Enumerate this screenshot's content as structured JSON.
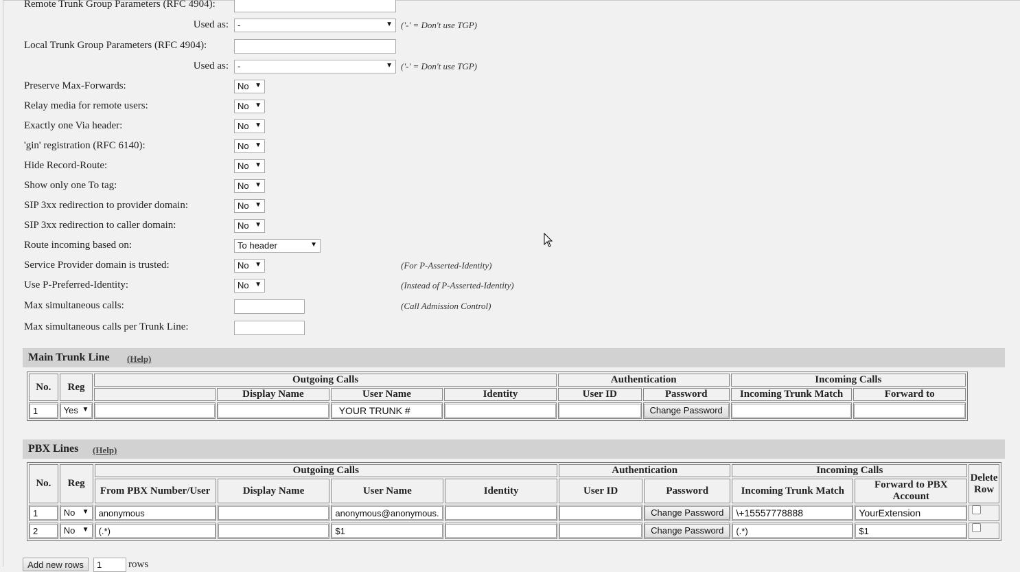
{
  "settings": [
    {
      "label": "Remote Trunk Group Parameters (RFC 4904):",
      "type": "text",
      "value": "",
      "note": ""
    },
    {
      "label": "Used as:",
      "type": "select",
      "value": "-",
      "note": "('-' = Don't use TGP)"
    },
    {
      "label": "Local Trunk Group Parameters (RFC 4904):",
      "type": "text",
      "value": "",
      "note": ""
    },
    {
      "label": "Used as:",
      "type": "select",
      "value": "-",
      "note": "('-' = Don't use TGP)"
    },
    {
      "label": "Preserve Max-Forwards:",
      "type": "select",
      "value": "No",
      "note": ""
    },
    {
      "label": "Relay media for remote users:",
      "type": "select",
      "value": "No",
      "note": ""
    },
    {
      "label": "Exactly one Via header:",
      "type": "select",
      "value": "No",
      "note": ""
    },
    {
      "label": "'gin' registration (RFC 6140):",
      "type": "select",
      "value": "No",
      "note": ""
    },
    {
      "label": "Hide Record-Route:",
      "type": "select",
      "value": "No",
      "note": ""
    },
    {
      "label": "Show only one To tag:",
      "type": "select",
      "value": "No",
      "note": ""
    },
    {
      "label": "SIP 3xx redirection to provider domain:",
      "type": "select",
      "value": "No",
      "note": ""
    },
    {
      "label": "SIP 3xx redirection to caller domain:",
      "type": "select",
      "value": "No",
      "note": ""
    },
    {
      "label": "Route incoming based on:",
      "type": "select",
      "value": "To header",
      "note": ""
    },
    {
      "label": "Service Provider domain is trusted:",
      "type": "select",
      "value": "No",
      "note": "(For P-Asserted-Identity)"
    },
    {
      "label": "Use P-Preferred-Identity:",
      "type": "select",
      "value": "No",
      "note": "(Instead of P-Asserted-Identity)"
    },
    {
      "label": "Max simultaneous calls:",
      "type": "text",
      "value": "",
      "note": "(Call Admission Control)"
    },
    {
      "label": "Max simultaneous calls per Trunk Line:",
      "type": "text",
      "value": "",
      "note": ""
    }
  ],
  "main_trunk": {
    "title": "Main Trunk Line",
    "help": "(Help)",
    "groups": {
      "outgoing": "Outgoing Calls",
      "auth": "Authentication",
      "incoming": "Incoming Calls"
    },
    "headers": {
      "no": "No.",
      "reg": "Reg",
      "display_name": "Display Name",
      "user_name": "User Name",
      "identity": "Identity",
      "user_id": "User ID",
      "password": "Password",
      "trunk_match": "Incoming Trunk Match",
      "forward_to": "Forward to"
    },
    "rows": [
      {
        "no": "1",
        "reg": "Yes",
        "from": "",
        "display_name": "",
        "user_name": "YOUR TRUNK #",
        "identity": "",
        "user_id": "",
        "password_btn": "Change Password",
        "trunk_match": "",
        "forward_to": ""
      }
    ]
  },
  "pbx_lines": {
    "title": "PBX Lines",
    "help": "(Help)",
    "groups": {
      "outgoing": "Outgoing Calls",
      "auth": "Authentication",
      "incoming": "Incoming Calls"
    },
    "headers": {
      "no": "No.",
      "reg": "Reg",
      "from": "From PBX Number/User",
      "display_name": "Display Name",
      "user_name": "User Name",
      "identity": "Identity",
      "user_id": "User ID",
      "password": "Password",
      "trunk_match": "Incoming Trunk Match",
      "forward_to": "Forward to PBX Account",
      "delete": "Delete Row"
    },
    "rows": [
      {
        "no": "1",
        "reg": "No",
        "from": "anonymous",
        "display_name": "",
        "user_name": "anonymous@anonymous.i",
        "identity": "",
        "user_id": "",
        "password_btn": "Change Password",
        "trunk_match": "\\+15557778888",
        "forward_to": "YourExtension"
      },
      {
        "no": "2",
        "reg": "No",
        "from": "(.*)",
        "display_name": "",
        "user_name": "$1",
        "identity": "",
        "user_id": "",
        "password_btn": "Change Password",
        "trunk_match": "(.*)",
        "forward_to": "$1"
      }
    ]
  },
  "footer": {
    "add_button": "Add new rows",
    "rows_value": "1",
    "rows_label": "rows"
  }
}
